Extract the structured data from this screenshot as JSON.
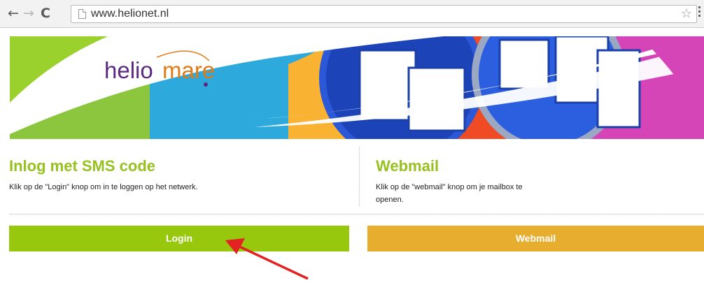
{
  "browser": {
    "url": "www.helionet.nl",
    "back_icon": "←",
    "forward_icon": "→",
    "reload_icon": "C",
    "star_icon": "☆"
  },
  "banner": {
    "logo_text_dark": "helio",
    "logo_text_accent": "mare",
    "stripe_colors": [
      "#8cc63e",
      "#2ea9dc",
      "#f9b231",
      "#ef4b24",
      "#d545b8"
    ]
  },
  "login_section": {
    "title": "Inlog met SMS code",
    "description": "Klik op de \"Login\" knop om in te loggen op het netwerk.",
    "button_label": "Login",
    "color": "#97c80e"
  },
  "webmail_section": {
    "title": "Webmail",
    "description_line1": "Klik op de \"webmail\" knop om je mailbox te",
    "description_line2": "openen.",
    "button_label": "Webmail",
    "color": "#e7ad2f"
  },
  "annotation": {
    "arrow_color": "#e32222"
  }
}
